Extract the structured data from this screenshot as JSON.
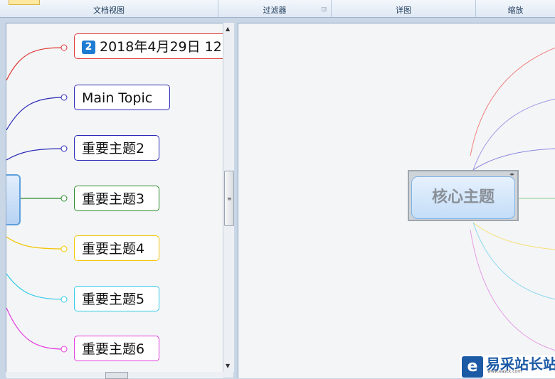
{
  "ribbon": {
    "groups": [
      {
        "label": "文档视图"
      },
      {
        "label": "过滤器"
      },
      {
        "label": "详图"
      },
      {
        "label": "缩放"
      }
    ]
  },
  "left_pane": {
    "topics": [
      {
        "number": "2",
        "label": "2018年4月29日 12",
        "color": "#e03a3a"
      },
      {
        "label": "Main Topic",
        "color": "#2a2ab8"
      },
      {
        "label": "重要主题2",
        "color": "#2a2ab8"
      },
      {
        "label": "重要主题3",
        "color": "#2a8a2a"
      },
      {
        "label": "重要主题4",
        "color": "#f2c400"
      },
      {
        "label": "重要主题5",
        "color": "#30c9e8"
      },
      {
        "label": "重要主题6",
        "color": "#e23ce0"
      }
    ]
  },
  "right_pane": {
    "central_topic": "核心主题",
    "branch_colors": [
      "#f08080",
      "#9a9ae8",
      "#8888e0",
      "#88cc88",
      "#f5e07a",
      "#8ad8f0",
      "#e49ae4"
    ]
  },
  "watermark": {
    "logo_glyph": "e",
    "text": "易采站长站",
    "url": "www.easck.com"
  }
}
